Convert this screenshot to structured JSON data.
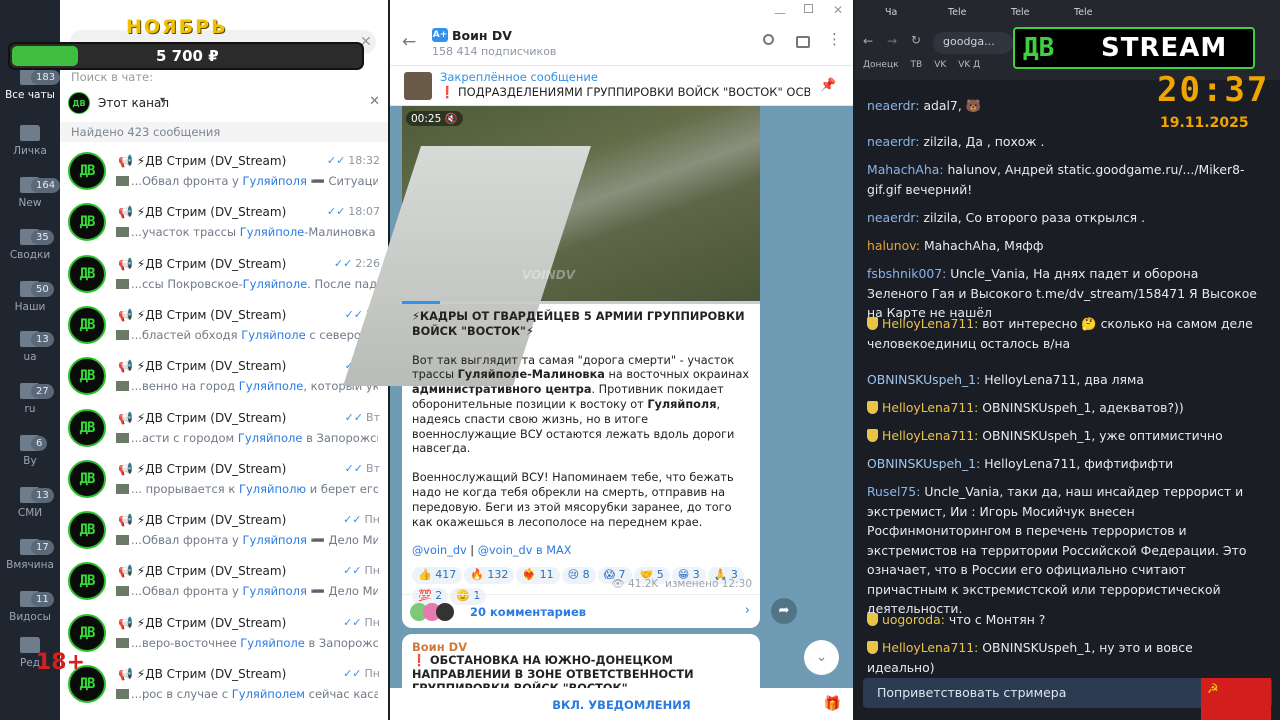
{
  "overlay": {
    "month_label": "НОЯБРЬ",
    "amount": "5 700 ₽",
    "age_rating": "18+",
    "stream_logo_left": "ДВ",
    "stream_logo_right": "STREAM",
    "clock_time": "20:37",
    "clock_date": "19.11.2025"
  },
  "rail": {
    "folders": [
      {
        "label": "Все чаты",
        "badge": "183"
      },
      {
        "label": "Личка",
        "badge": ""
      },
      {
        "label": "New",
        "badge": "164"
      },
      {
        "label": "Сводки",
        "badge": "35"
      },
      {
        "label": "Наши",
        "badge": "50"
      },
      {
        "label": "ua",
        "badge": "13"
      },
      {
        "label": "ru",
        "badge": "27"
      },
      {
        "label": "By",
        "badge": "6"
      },
      {
        "label": "СМИ",
        "badge": "13"
      },
      {
        "label": "Вмячина",
        "badge": "17"
      },
      {
        "label": "Видосы",
        "badge": "11"
      },
      {
        "label": "Ред",
        "badge": ""
      }
    ]
  },
  "chatlist": {
    "search_placeholder": "Поиск в чате:",
    "scope_label": "Этот канал",
    "found_label": "Найдено 423 сообщения",
    "rows": [
      {
        "title": "ДВ Стрим (DV_Stream)",
        "time": "18:32",
        "pre": "...Обвал фронта у ",
        "hl": "Гуляйполя",
        "post": " ➖ Ситуация на ..."
      },
      {
        "title": "ДВ Стрим (DV_Stream)",
        "time": "18:07",
        "pre": "...участок трассы ",
        "hl": "Гуляйполе",
        "post": "-Малиновка на во..."
      },
      {
        "title": "ДВ Стрим (DV_Stream)",
        "time": "2:26",
        "pre": "...ссы Покровское-",
        "hl": "Гуляйполе",
        "post": ". После падения об..."
      },
      {
        "title": "ДВ Стрим (DV_Stream)",
        "time": "Вт",
        "pre": "...бластей обходя ",
        "hl": "Гуляйполе",
        "post": " с северо-востока..."
      },
      {
        "title": "ДВ Стрим (DV_Stream)",
        "time": "Вт",
        "pre": "...венно на город ",
        "hl": "Гуляйполе",
        "post": ", который украин..."
      },
      {
        "title": "ДВ Стрим (DV_Stream)",
        "time": "Вт",
        "pre": "...асти с городом ",
        "hl": "Гуляйполе",
        "post": " в Запорожской. ..."
      },
      {
        "title": "ДВ Стрим (DV_Stream)",
        "time": "Вт",
        "pre": "... прорывается к ",
        "hl": "Гуляйполю",
        "post": " и берет его в кле..."
      },
      {
        "title": "ДВ Стрим (DV_Stream)",
        "time": "Пн",
        "pre": "...Обвал фронта у ",
        "hl": "Гуляйполя",
        "post": " ➖ Дело Мин..."
      },
      {
        "title": "ДВ Стрим (DV_Stream)",
        "time": "Пн",
        "pre": "...Обвал фронта у ",
        "hl": "Гуляйполя",
        "post": " ➖ Дело Миндич..."
      },
      {
        "title": "ДВ Стрим (DV_Stream)",
        "time": "Пн",
        "pre": "...веро-восточнее ",
        "hl": "Гуляйполе",
        "post": " в Запорожской ..."
      },
      {
        "title": "ДВ Стрим (DV_Stream)",
        "time": "Пн",
        "pre": "...рос в случае с ",
        "hl": "Гуляйполем",
        "post": " сейчас касается ..."
      }
    ]
  },
  "channel": {
    "name": "Воин DV",
    "subscribers": "158 414 подписчиков",
    "pinned_label": "Закреплённое сообщение",
    "pinned_text": "❗ ПОДРАЗДЕЛЕНИЯМИ ГРУППИРОВКИ ВОЙСК \"ВОСТОК\" ОСВОБОЖ...",
    "video_time": "00:25",
    "watermark": "VOINDV",
    "post": {
      "headline": "⚡КАДРЫ ОТ ГВАРДЕЙЦЕВ 5 АРМИИ ГРУППИРОВКИ ВОЙСК \"ВОСТОК\"⚡",
      "p1_a": "Вот так выглядит та самая \"дорога смерти\" - участок трассы ",
      "p1_b": "Гуляйполе-Малиновка",
      "p1_c": " на восточных окраинах ",
      "p1_d": "административного центра",
      "p1_e": ". Противник покидает оборонительные позиции к востоку от ",
      "p1_f": "Гуляйполя",
      "p1_g": ", надеясь спасти свою жизнь, но в итоге военнослужащие ВСУ остаются лежать вдоль дороги навсегда.",
      "p2": "Военнослужащий ВСУ! Напоминаем тебе, что бежать надо не когда тебя обрекли на смерть, отправив на передовую. Беги из этой мясорубки заранее, до того как окажешься в лесополосе на переднем крае.",
      "link1": "@voin_dv",
      "link2": "@voin_dv в MAX",
      "reactions": [
        "👍 417",
        "🔥 132",
        "❤️‍🔥 11",
        "😢 8",
        "😱 7",
        "🤝 5",
        "😁 3",
        "🙏 3",
        "💯 2",
        "🫡 1"
      ],
      "views": "41.2K",
      "edited": "изменено 12:30",
      "comments": "20 комментариев"
    },
    "next_post": {
      "author": "Воин DV",
      "text": "❗ ОБСТАНОВКА НА ЮЖНО-ДОНЕЦКОМ НАПРАВЛЕНИИ В ЗОНЕ ОТВЕТСТВЕННОСТИ ГРУППИРОВКИ ВОЙСК \"ВОСТОК\""
    },
    "unmute": "ВКЛ. УВЕДОМЛЕНИЯ"
  },
  "browser": {
    "tabs": [
      "Ча",
      "Tele",
      "Tele",
      "Tele"
    ],
    "url": "goodga...",
    "bookmarks": [
      "Донецк",
      "ТВ",
      "VK",
      "VK Д"
    ]
  },
  "stream_chat": {
    "messages": [
      {
        "name": "neaerdr",
        "text": "adal7, 🐻",
        "color": "n1",
        "mod": false
      },
      {
        "name": "neaerdr",
        "text": "zilzila, Да , похож .",
        "color": "n1",
        "mod": false
      },
      {
        "name": "MahachAha",
        "text": "halunov, Андрей static.goodgame.ru/.../Miker8-gif.gif вечерний!",
        "color": "n1",
        "mod": false
      },
      {
        "name": "neaerdr",
        "text": "zilzila, Со второго раза открылся .",
        "color": "n1",
        "mod": false
      },
      {
        "name": "halunov",
        "text": "MahachAha, Мяфф",
        "color": "n2",
        "mod": false
      },
      {
        "name": "fsbshnik007",
        "text": "Uncle_Vania, На днях падет и оборона Зеленого Гая и Высокого t.me/dv_stream/158471 Я Высокое на Карте не нашёл",
        "color": "n1",
        "mod": false
      },
      {
        "name": "HelloyLena711",
        "text": "вот интересно 🤔 сколько на самом деле человекоединиц осталось в/на",
        "color": "n3",
        "mod": true
      },
      {
        "name": "OBNINSKUspeh_1",
        "text": "HelloyLena711, два ляма",
        "color": "n4",
        "mod": false
      },
      {
        "name": "HelloyLena711",
        "text": "OBNINSKUspeh_1, адекватов?))",
        "color": "n3",
        "mod": true
      },
      {
        "name": "HelloyLena711",
        "text": "OBNINSKUspeh_1, уже оптимистично",
        "color": "n3",
        "mod": true
      },
      {
        "name": "OBNINSKUspeh_1",
        "text": "HelloyLena711, фифтифифти",
        "color": "n4",
        "mod": false
      },
      {
        "name": "Rusel75",
        "text": "Uncle_Vania, таки да, наш инсайдер террорист и экстремист, Ии : Игорь Мосийчук внесен Росфинмониторингом в перечень террористов и экстремистов на территории Российской Федерации. Это означает, что в России его официально считают причастным к экстремистской или террористической деятельности.",
        "color": "n1",
        "mod": false
      },
      {
        "name": "uogoroda",
        "text": "что с Монтян ?",
        "color": "n3",
        "mod": true
      },
      {
        "name": "HelloyLena711",
        "text": "OBNINSKUspeh_1, ну это и вовсе идеально)",
        "color": "n3",
        "mod": true
      }
    ],
    "greet_button": "Поприветствовать стримера"
  }
}
